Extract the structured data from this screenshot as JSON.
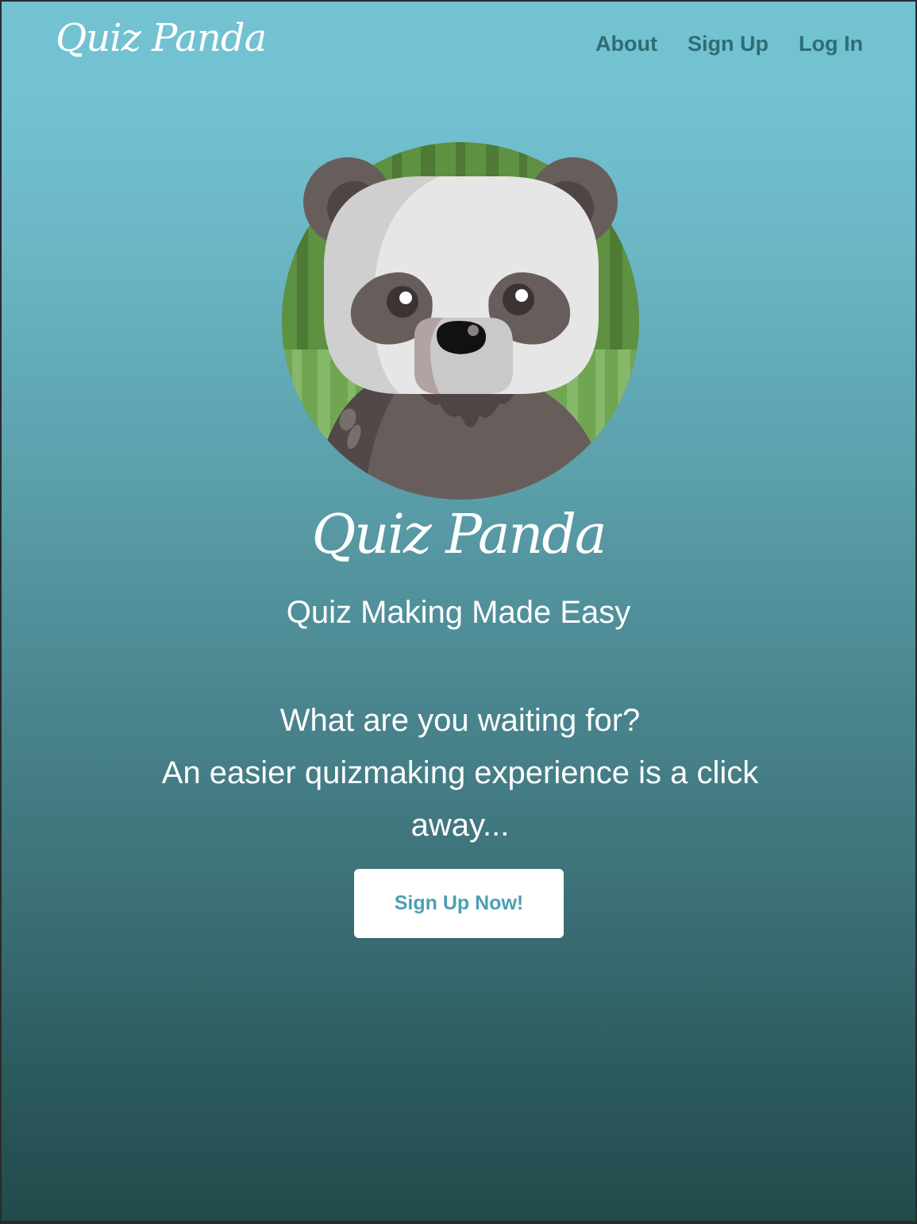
{
  "navbar": {
    "brand": "Quiz Panda",
    "links": [
      {
        "label": "About"
      },
      {
        "label": "Sign Up"
      },
      {
        "label": "Log In"
      }
    ]
  },
  "hero": {
    "logo_icon": "panda-avatar-icon",
    "title": "Quiz Panda",
    "tagline": "Quiz Making Made Easy",
    "pitch_line1": "What are you waiting for?",
    "pitch_line2": "An easier quizmaking experience is a click away...",
    "cta_label": "Sign Up Now!"
  },
  "colors": {
    "navbar_bg": "#72c2d1",
    "nav_link": "#2d6d75",
    "gradient_top": "#76c9d8",
    "gradient_bottom": "#224a4c",
    "cta_text": "#4aa0b1",
    "bamboo_green": "#5a8e40"
  }
}
